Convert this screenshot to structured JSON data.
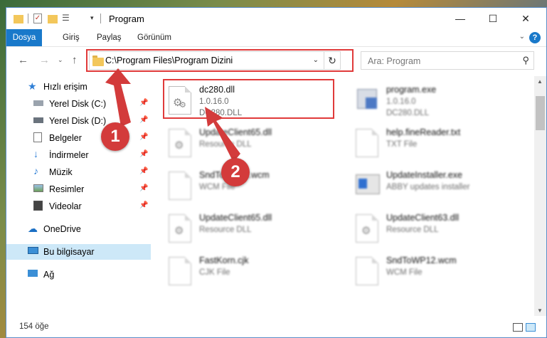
{
  "window": {
    "title": "Program",
    "controls": {
      "minimize": "—",
      "maximize": "☐",
      "close": "✕"
    }
  },
  "ribbon": {
    "tabs": [
      "Dosya",
      "Giriş",
      "Paylaş",
      "Görünüm"
    ],
    "help": "?"
  },
  "nav": {
    "address": "C:\\Program Files\\Program Dizini",
    "search_placeholder": "Ara: Program"
  },
  "sidebar": {
    "items": [
      {
        "label": "Hızlı erişim",
        "icon": "star-icon"
      },
      {
        "label": "Yerel Disk (C:)",
        "icon": "drive-icon",
        "pinned": true
      },
      {
        "label": "Yerel Disk (D:)",
        "icon": "drive-icon",
        "pinned": true
      },
      {
        "label": "Belgeler",
        "icon": "documents-icon",
        "pinned": true
      },
      {
        "label": "İndirmeler",
        "icon": "download-icon",
        "pinned": true
      },
      {
        "label": "Müzik",
        "icon": "music-icon",
        "pinned": true
      },
      {
        "label": "Resimler",
        "icon": "pictures-icon",
        "pinned": true
      },
      {
        "label": "Videolar",
        "icon": "videos-icon",
        "pinned": true
      },
      {
        "label": "OneDrive",
        "icon": "cloud-icon"
      },
      {
        "label": "Bu bilgisayar",
        "icon": "computer-icon",
        "selected": true
      },
      {
        "label": "Ağ",
        "icon": "network-icon"
      }
    ]
  },
  "files": [
    {
      "name": "dc280.dll",
      "line2": "1.0.16.0",
      "line3": "DC280.DLL"
    },
    {
      "name": "program.exe",
      "line2": "1.0.16.0",
      "line3": "DC280.DLL"
    },
    {
      "name": "UpdateClient65.dll",
      "line2": "Resource DLL",
      "line3": ""
    },
    {
      "name": "help.fineReader.txt",
      "line2": "TXT File",
      "line3": ""
    },
    {
      "name": "SndToWP16.wcm",
      "line2": "WCM File",
      "line3": ""
    },
    {
      "name": "UpdateInstaller.exe",
      "line2": "ABBY updates installer",
      "line3": ""
    },
    {
      "name": "UpdateClient65.dll",
      "line2": "Resource DLL",
      "line3": ""
    },
    {
      "name": "UpdateClient63.dll",
      "line2": "Resource DLL",
      "line3": ""
    },
    {
      "name": "FastKorn.cjk",
      "line2": "CJK File",
      "line3": ""
    },
    {
      "name": "SndToWP12.wcm",
      "line2": "WCM File",
      "line3": ""
    }
  ],
  "status": {
    "count": "154 öğe"
  },
  "annotations": {
    "step1": "1",
    "step2": "2",
    "color": "#d33b3b"
  }
}
